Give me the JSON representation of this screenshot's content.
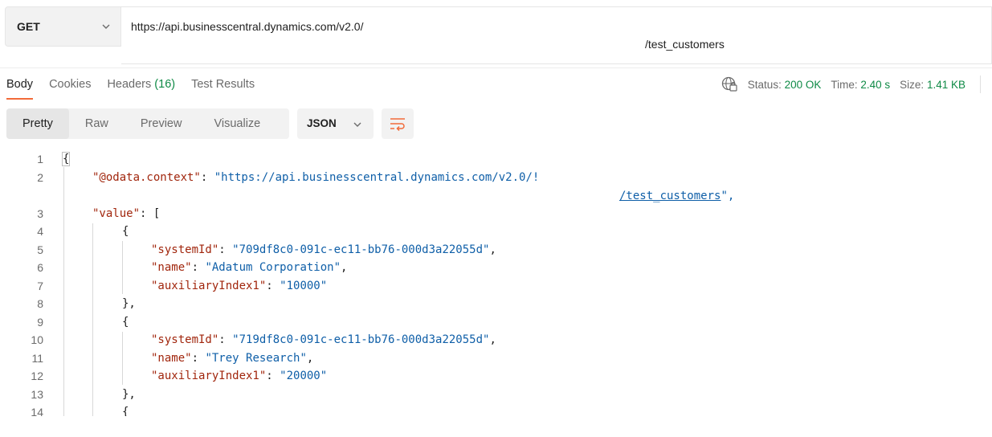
{
  "request": {
    "method": "GET",
    "url_line1": "https://api.businesscentral.dynamics.com/v2.0/",
    "url_line2": "/test_customers"
  },
  "response_tabs": {
    "body": "Body",
    "cookies": "Cookies",
    "headers": "Headers",
    "headers_count": "(16)",
    "test_results": "Test Results"
  },
  "response_meta": {
    "status_label": "Status:",
    "status_value": "200 OK",
    "time_label": "Time:",
    "time_value": "2.40 s",
    "size_label": "Size:",
    "size_value": "1.41 KB",
    "icon": "globe-icon"
  },
  "view_toolbar": {
    "modes": [
      "Pretty",
      "Raw",
      "Preview",
      "Visualize"
    ],
    "active_mode": "Pretty",
    "format": "JSON",
    "wrap_icon": "wrap-lines-icon"
  },
  "code": {
    "line_numbers": [
      "1",
      "2",
      "3",
      "4",
      "5",
      "6",
      "7",
      "8",
      "9",
      "10",
      "11",
      "12",
      "13",
      "14"
    ],
    "open_brace": "{",
    "context_key": "\"@odata.context\"",
    "context_value_part1": "\"https://api.businesscentral.dynamics.com/v2.0/!",
    "context_value_part2": "/test_customers",
    "context_value_tail": "\",",
    "value_key": "\"value\"",
    "value_open": ": [",
    "records": [
      {
        "systemId_key": "\"systemId\"",
        "systemId": "\"709df8c0-091c-ec11-bb76-000d3a22055d\"",
        "name_key": "\"name\"",
        "name": "\"Adatum Corporation\"",
        "aux_key": "\"auxiliaryIndex1\"",
        "aux": "\"10000\""
      },
      {
        "systemId_key": "\"systemId\"",
        "systemId": "\"719df8c0-091c-ec11-bb76-000d3a22055d\"",
        "name_key": "\"name\"",
        "name": "\"Trey Research\"",
        "aux_key": "\"auxiliaryIndex1\"",
        "aux": "\"20000\""
      }
    ],
    "close_obj": "},",
    "open_obj": "{"
  }
}
